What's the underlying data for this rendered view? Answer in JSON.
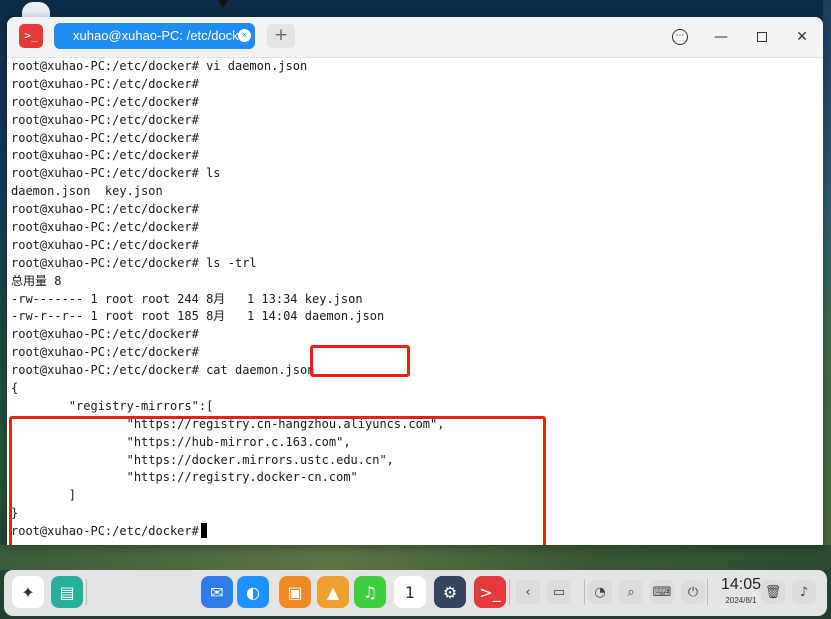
{
  "window": {
    "app_icon_glyph": ">_",
    "tab_title": "xuhao@xuhao-PC: /etc/docker",
    "tab_close_glyph": "×",
    "add_tab_glyph": "+",
    "controls": {
      "menu": "⋯",
      "minimize": "—",
      "close": "✕"
    }
  },
  "terminal": {
    "lines": [
      "root@xuhao-PC:/etc/docker# vi daemon.json",
      "root@xuhao-PC:/etc/docker#",
      "root@xuhao-PC:/etc/docker#",
      "root@xuhao-PC:/etc/docker#",
      "root@xuhao-PC:/etc/docker#",
      "root@xuhao-PC:/etc/docker#",
      "root@xuhao-PC:/etc/docker# ls",
      "daemon.json  key.json",
      "root@xuhao-PC:/etc/docker#",
      "root@xuhao-PC:/etc/docker#",
      "root@xuhao-PC:/etc/docker#",
      "root@xuhao-PC:/etc/docker# ls -trl",
      "总用量 8",
      "-rw------- 1 root root 244 8月   1 13:34 key.json",
      "-rw-r--r-- 1 root root 185 8月   1 14:04 daemon.json",
      "root@xuhao-PC:/etc/docker#",
      "root@xuhao-PC:/etc/docker#",
      "root@xuhao-PC:/etc/docker# cat daemon.json",
      "{",
      "        \"registry-mirrors\":[",
      "                \"https://registry.cn-hangzhou.aliyuncs.com\",",
      "                \"https://hub-mirror.c.163.com\",",
      "                \"https://docker.mirrors.ustc.edu.cn\",",
      "                \"https://registry.docker-cn.com\"",
      "        ]",
      "}",
      "root@xuhao-PC:/etc/docker#"
    ]
  },
  "highlight_color": "#e8201c",
  "accent_color": "#1f8cf0",
  "dock": {
    "items": [
      {
        "name": "launcher-icon",
        "glyph": "✦",
        "color": "#ffffff"
      },
      {
        "name": "multitask-icon",
        "glyph": "▤",
        "color": "#25b09a"
      },
      {
        "name": "file-manager-icon",
        "glyph": "✉",
        "color": "#2e7de9"
      },
      {
        "name": "browser-icon",
        "glyph": "◐",
        "color": "#1e90ff"
      },
      {
        "name": "app-store-icon",
        "glyph": "▣",
        "color": "#f08a24"
      },
      {
        "name": "image-viewer-icon",
        "glyph": "▲",
        "color": "#f0a030"
      },
      {
        "name": "music-icon",
        "glyph": "♫",
        "color": "#3ecf3e"
      },
      {
        "name": "calendar-icon",
        "glyph": "1",
        "color": "#ffffff"
      },
      {
        "name": "settings-icon",
        "glyph": "⚙",
        "color": "#36455e"
      },
      {
        "name": "terminal-icon",
        "glyph": ">_",
        "color": "#e53a3a"
      }
    ],
    "tray": [
      {
        "name": "hide-dock-icon",
        "glyph": "‹"
      },
      {
        "name": "notification-icon",
        "glyph": "▭"
      },
      {
        "name": "monitor-icon",
        "glyph": "◔"
      },
      {
        "name": "search-icon",
        "glyph": "⌕"
      },
      {
        "name": "keyboard-icon",
        "glyph": "⌨"
      },
      {
        "name": "power-icon",
        "glyph": "⏻"
      }
    ],
    "clock_time": "14:05",
    "clock_date": "2024/8/1",
    "trash_glyph": "🗑",
    "notification_glyph": "♪"
  }
}
